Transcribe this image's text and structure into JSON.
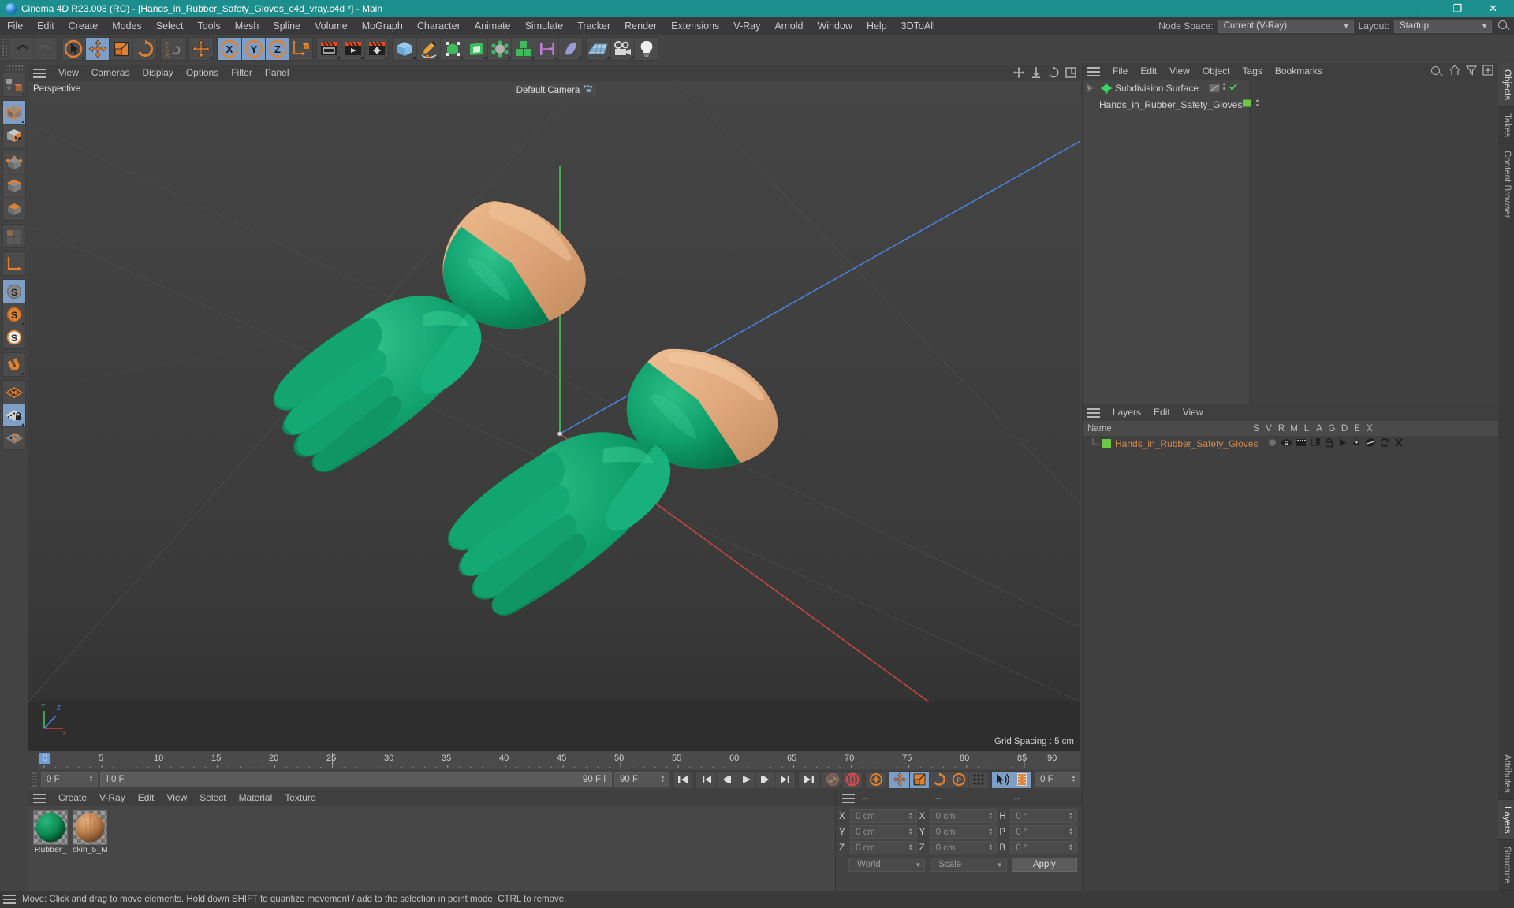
{
  "titlebar": {
    "title": "Cinema 4D R23.008 (RC) - [Hands_in_Rubber_Safety_Gloves_c4d_vray.c4d *] - Main",
    "minimize": "−",
    "maximize": "❐",
    "close": "✕"
  },
  "menubar": {
    "items": [
      "File",
      "Edit",
      "Create",
      "Modes",
      "Select",
      "Tools",
      "Mesh",
      "Spline",
      "Volume",
      "MoGraph",
      "Character",
      "Animate",
      "Simulate",
      "Tracker",
      "Render",
      "Extensions",
      "V-Ray",
      "Arnold",
      "Window",
      "Help",
      "3DToAll"
    ],
    "node_space_label": "Node Space:",
    "node_space_value": "Current (V-Ray)",
    "layout_label": "Layout:",
    "layout_value": "Startup"
  },
  "viewport": {
    "menu": [
      "View",
      "Cameras",
      "Display",
      "Options",
      "Filter",
      "Panel"
    ],
    "label": "Perspective",
    "camera": "Default Camera",
    "grid_spacing": "Grid Spacing : 5 cm",
    "axis_x": "X",
    "axis_y": "Y",
    "axis_z": "Z"
  },
  "timeline": {
    "ticks": [
      "0",
      "5",
      "10",
      "15",
      "20",
      "25",
      "30",
      "35",
      "40",
      "45",
      "50",
      "55",
      "60",
      "65",
      "70",
      "75",
      "80",
      "85",
      "90"
    ],
    "current_frame": "0 F",
    "range_start": "0 F",
    "range_end": "90 F",
    "end_field": "90 F",
    "preview_end": "90 F",
    "right_frame": "0 F"
  },
  "materials": {
    "menu": [
      "Create",
      "V-Ray",
      "Edit",
      "View",
      "Select",
      "Material",
      "Texture"
    ],
    "items": [
      {
        "name": "Rubber_",
        "color": "#148a52"
      },
      {
        "name": "skin_5_M",
        "color": "#c08a57"
      }
    ]
  },
  "coordinates": {
    "header": [
      "--",
      "--",
      "--"
    ],
    "position": {
      "label_x": "X",
      "label_y": "Y",
      "label_z": "Z",
      "x": "0 cm",
      "y": "0 cm",
      "z": "0 cm"
    },
    "size": {
      "label_x": "X",
      "label_y": "Y",
      "label_z": "Z",
      "x": "0 cm",
      "y": "0 cm",
      "z": "0 cm"
    },
    "rotation": {
      "label_h": "H",
      "label_p": "P",
      "label_b": "B",
      "h": "0 °",
      "p": "0 °",
      "b": "0 °"
    },
    "system": "World",
    "mode": "Scale",
    "apply": "Apply"
  },
  "objects": {
    "menu": [
      "File",
      "Edit",
      "View",
      "Object",
      "Tags",
      "Bookmarks"
    ],
    "rows": [
      {
        "name": "Subdivision Surface",
        "indent": 0,
        "color": "#58d858"
      },
      {
        "name": "Hands_in_Rubber_Safety_Gloves",
        "indent": 1,
        "color": "#6aa9e0"
      }
    ]
  },
  "layers": {
    "menu": [
      "Layers",
      "Edit",
      "View"
    ],
    "name_header": "Name",
    "columns": [
      "S",
      "V",
      "R",
      "M",
      "L",
      "A",
      "G",
      "D",
      "E",
      "X"
    ],
    "rows": [
      {
        "name": "Hands_in_Rubber_Safety_Gloves",
        "swatch": "#6bc746"
      }
    ]
  },
  "right_tabs_top": [
    "Objects",
    "Takes",
    "Content Browser"
  ],
  "right_tabs_bottom": [
    "Attributes",
    "Layers",
    "Structure"
  ],
  "statusbar": {
    "message": "Move: Click and drag to move elements. Hold down SHIFT to quantize movement / add to the selection in point mode, CTRL to remove."
  },
  "icons": {
    "undo": "undo-icon",
    "redo": "redo-icon",
    "select": "live-selection-icon",
    "move": "move-icon",
    "scale": "scale-icon",
    "rotate": "rotate-icon",
    "psr": "psr-icon",
    "world": "world-axis-icon",
    "lock_x": "lock-x-icon",
    "lock_y": "lock-y-icon",
    "lock_z": "lock-z-icon",
    "coordinate_system": "object-world-coordinate-icon",
    "render_view": "render-view-icon",
    "render_picture": "render-picture-icon",
    "render_queue": "render-queue-icon",
    "render_settings": "render-settings-icon",
    "cube": "primitive-cube-icon",
    "spline": "spline-pen-icon",
    "nurbs": "generator-icon",
    "deformer": "deformer-icon",
    "environment": "environment-icon",
    "array": "array-icon",
    "scene": "scene-icon",
    "field": "field-icon",
    "floor": "floor-icon",
    "camera": "camera-icon",
    "light": "light-icon"
  },
  "colors": {
    "accent_teal": "#1c8e8e",
    "toolbar_bg": "#434343",
    "panel_bg": "#404040",
    "active_blue": "#7d9ec7",
    "orange": "#e08030",
    "glove_green": "#11a06a",
    "skin": "#e0ab7a"
  }
}
